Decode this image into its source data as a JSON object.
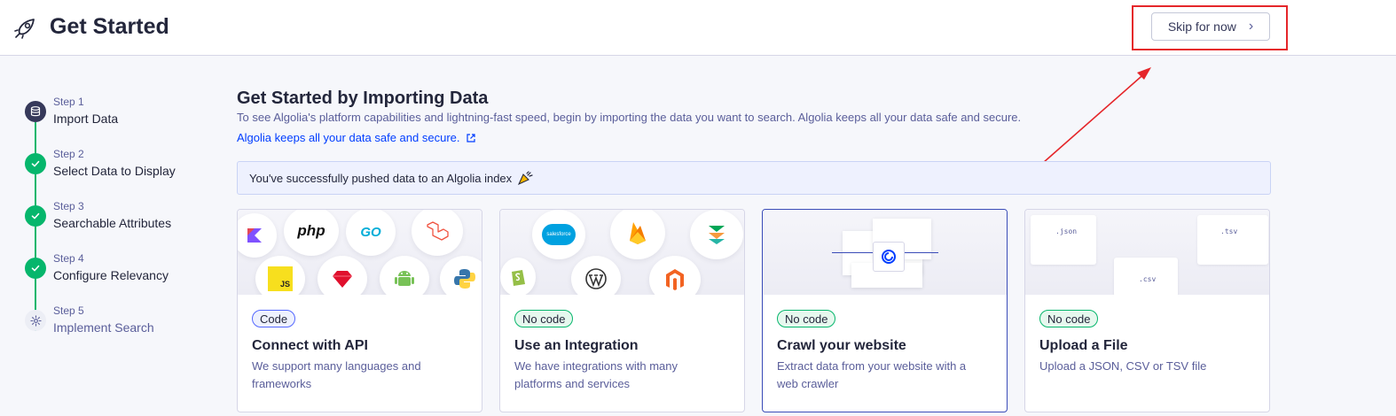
{
  "header": {
    "title": "Get Started",
    "skip_label": "Skip for now"
  },
  "steps": [
    {
      "step_label": "Step 1",
      "name": "Import Data",
      "state": "active"
    },
    {
      "step_label": "Step 2",
      "name": "Select Data to Display",
      "state": "done"
    },
    {
      "step_label": "Step 3",
      "name": "Searchable Attributes",
      "state": "done"
    },
    {
      "step_label": "Step 4",
      "name": "Configure Relevancy",
      "state": "done"
    },
    {
      "step_label": "Step 5",
      "name": "Implement Search",
      "state": "pending"
    }
  ],
  "main": {
    "heading": "Get Started by Importing Data",
    "description": "To see Algolia's platform capabilities and lightning-fast speed, begin by importing the data you want to search. Algolia keeps all your data safe and secure.",
    "link_text": "Algolia keeps all your data safe and secure.",
    "banner_text": "You've successfully pushed data to an Algolia index",
    "banner_icon": "party-popper-icon"
  },
  "cards": [
    {
      "badge": "Code",
      "title": "Connect with API",
      "desc": "We support many languages and frameworks"
    },
    {
      "badge": "No code",
      "title": "Use an Integration",
      "desc": "We have integrations with many platforms and services"
    },
    {
      "badge": "No code",
      "title": "Crawl your website",
      "desc": "Extract data from your website with a web crawler"
    },
    {
      "badge": "No code",
      "title": "Upload a File",
      "desc": "Upload a JSON, CSV or TSV file"
    }
  ],
  "art": {
    "api_php": "php",
    "api_go": "GO",
    "api_js": "JS",
    "salesforce": "salesforce",
    "file_json": ".json",
    "file_tsv": ".tsv",
    "file_csv": ".csv"
  },
  "colors": {
    "accent": "#003dff",
    "success": "#06b66c",
    "annotation": "#e5262a"
  }
}
